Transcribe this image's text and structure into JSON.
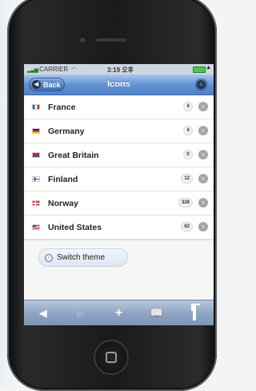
{
  "statusbar": {
    "carrier": "CARRIER",
    "time": "3:19 오후"
  },
  "navbar": {
    "back_label": "Back",
    "title": "Icons"
  },
  "countries": [
    {
      "name": "France",
      "count": "4",
      "flag": "fr"
    },
    {
      "name": "Germany",
      "count": "4",
      "flag": "de"
    },
    {
      "name": "Great Britain",
      "count": "0",
      "flag": "gb"
    },
    {
      "name": "Finland",
      "count": "12",
      "flag": "fi"
    },
    {
      "name": "Norway",
      "count": "328",
      "flag": "no"
    },
    {
      "name": "United States",
      "count": "62",
      "flag": "us"
    }
  ],
  "theme_button": {
    "label": "Switch theme"
  },
  "toolbar": [
    "back-arrow-icon",
    "forward-arrow-icon",
    "add-icon",
    "bookmarks-icon",
    "pages-icon"
  ],
  "colors": {
    "navbar": "#5e8fd1",
    "toolbar": "#8ca3c1"
  }
}
